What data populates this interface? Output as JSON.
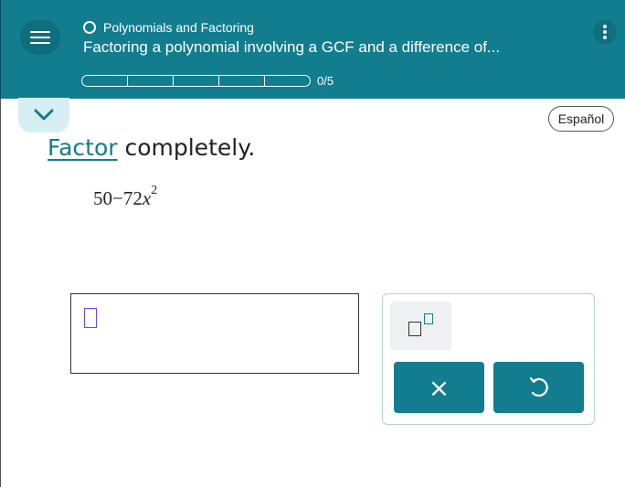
{
  "header": {
    "topic": "Polynomials and Factoring",
    "lesson_title": "Factoring a polynomial involving a GCF and a difference of...",
    "progress": {
      "completed": 0,
      "total": 5,
      "text": "0/5"
    },
    "icons": [
      "menu-icon",
      "topic-circle-icon",
      "kebab-menu-icon"
    ]
  },
  "toolbar": {
    "language_label": "Español",
    "collapse_icon": "chevron-down-icon"
  },
  "question": {
    "instruction_link": "Factor",
    "instruction_rest": " completely.",
    "expression": {
      "constant": "50",
      "operator": "−",
      "coefficient": "72",
      "variable": "x",
      "exponent": "2"
    }
  },
  "answer": {
    "value": ""
  },
  "tools": {
    "superscript_icon": "superscript-icon",
    "clear_label": "×",
    "undo_icon": "undo-icon"
  },
  "colors": {
    "header_bg": "#127d8f",
    "tab_bg": "#d7eef2",
    "cursor": "#6c3fff",
    "button_bg": "#127d8f"
  }
}
